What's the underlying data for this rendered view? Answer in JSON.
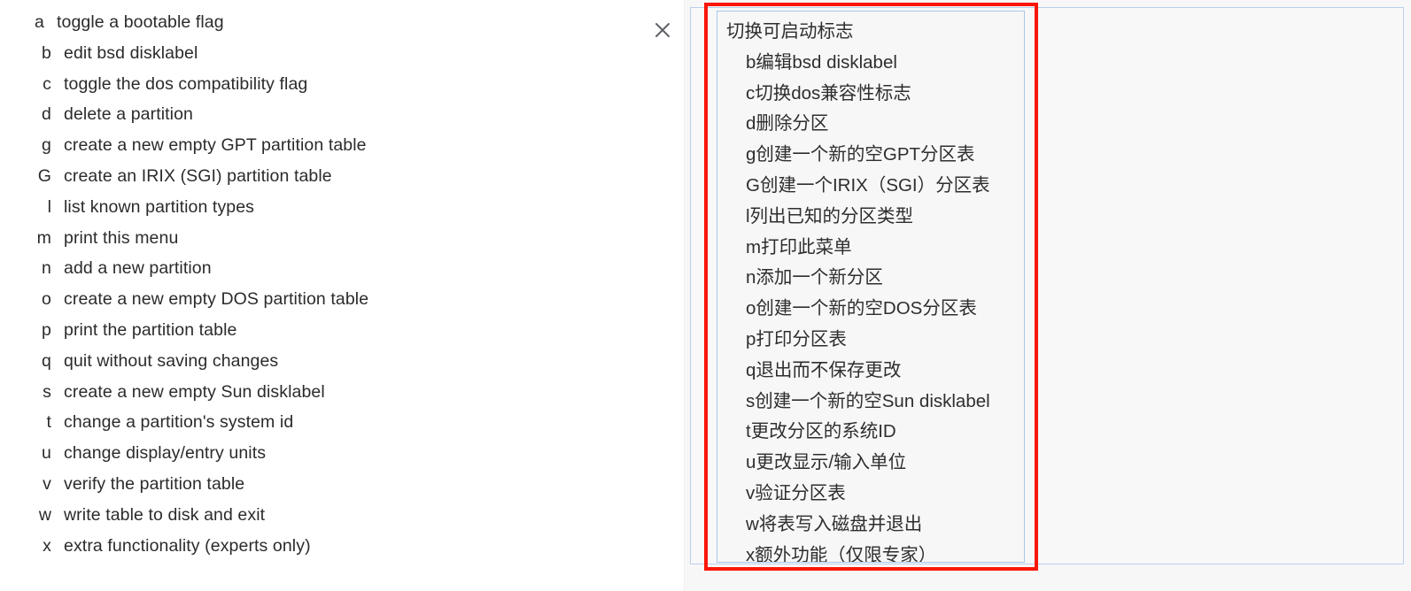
{
  "source_pane": {
    "name": "fdisk-menu-source-text",
    "text_color": "#2b2b2b",
    "background": "#ffffff",
    "rows": [
      {
        "key": "a",
        "desc": "toggle a bootable flag"
      },
      {
        "key": "b",
        "desc": "edit bsd disklabel"
      },
      {
        "key": "c",
        "desc": "toggle the dos compatibility flag"
      },
      {
        "key": "d",
        "desc": "delete a partition"
      },
      {
        "key": "g",
        "desc": "create a new empty GPT partition table"
      },
      {
        "key": "G",
        "desc": "create an IRIX (SGI) partition table"
      },
      {
        "key": "l",
        "desc": "list known partition types"
      },
      {
        "key": "m",
        "desc": "print this menu"
      },
      {
        "key": "n",
        "desc": "add a new partition"
      },
      {
        "key": "o",
        "desc": "create a new empty DOS partition table"
      },
      {
        "key": "p",
        "desc": "print the partition table"
      },
      {
        "key": "q",
        "desc": "quit without saving changes"
      },
      {
        "key": "s",
        "desc": "create a new empty Sun disklabel"
      },
      {
        "key": "t",
        "desc": "change a partition's system id"
      },
      {
        "key": "u",
        "desc": "change display/entry units"
      },
      {
        "key": "v",
        "desc": "verify the partition table"
      },
      {
        "key": "w",
        "desc": "write table to disk and exit"
      },
      {
        "key": "x",
        "desc": "extra functionality (experts only)"
      }
    ]
  },
  "close_button": {
    "icon": "close-icon",
    "glyph": "✕",
    "color": "#5f6368"
  },
  "translation_pane": {
    "name": "translated-result-panel",
    "background": "#f8f7f7",
    "frame_border_color": "#b9cfea",
    "card_border_color": "#a8c6e6",
    "card_background": "#f7f7f7",
    "highlight_border_color": "#fa1607",
    "text_color": "#2e2e2e",
    "lines": [
      {
        "text": "切换可启动标志",
        "indent": false
      },
      {
        "text": "b编辑bsd disklabel",
        "indent": true
      },
      {
        "text": "c切换dos兼容性标志",
        "indent": true
      },
      {
        "text": "d删除分区",
        "indent": true
      },
      {
        "text": "g创建一个新的空GPT分区表",
        "indent": true
      },
      {
        "text": "G创建一个IRIX（SGI）分区表",
        "indent": true
      },
      {
        "text": "l列出已知的分区类型",
        "indent": true
      },
      {
        "text": "m打印此菜单",
        "indent": true
      },
      {
        "text": "n添加一个新分区",
        "indent": true
      },
      {
        "text": "o创建一个新的空DOS分区表",
        "indent": true
      },
      {
        "text": "p打印分区表",
        "indent": true
      },
      {
        "text": "q退出而不保存更改",
        "indent": true
      },
      {
        "text": "s创建一个新的空Sun disklabel",
        "indent": true
      },
      {
        "text": "t更改分区的系统ID",
        "indent": true
      },
      {
        "text": "u更改显示/输入单位",
        "indent": true
      },
      {
        "text": "v验证分区表",
        "indent": true
      },
      {
        "text": "w将表写入磁盘并退出",
        "indent": true
      },
      {
        "text": "x额外功能（仅限专家）",
        "indent": true
      }
    ]
  }
}
